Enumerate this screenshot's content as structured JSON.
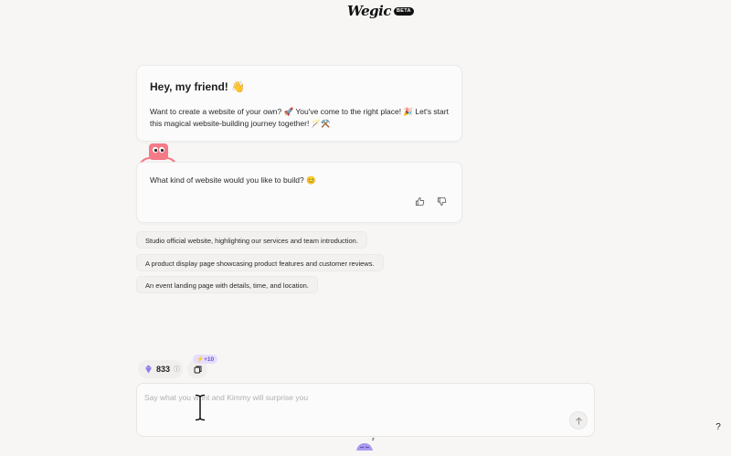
{
  "header": {
    "logo_text": "Wegic",
    "beta_label": "BETA"
  },
  "intro_card": {
    "title": "Hey, my friend! 👋",
    "body": "Want to create a website of your own? 🚀 You've come to the right place! 🎉 Let's start this magical website-building journey together! 🪄⚒️"
  },
  "question_card": {
    "text": "What kind of website would you like to build? 😊",
    "feedback_icons": [
      "thumbs-up-icon",
      "thumbs-down-icon"
    ]
  },
  "suggestions": [
    "Studio official website, highlighting our services and team introduction.",
    "A product display page showcasing product features and customer reviews.",
    "An event landing page with details, time, and location."
  ],
  "toolbar": {
    "credits": "833",
    "bonus_badge": "+10"
  },
  "composer": {
    "value": "",
    "placeholder": "Say what you want and Kimmy will surprise you"
  },
  "help_label": "?",
  "colors": {
    "accent": "#6b4fd8",
    "mascot": "#f47a86",
    "background": "#f7f6f5"
  }
}
